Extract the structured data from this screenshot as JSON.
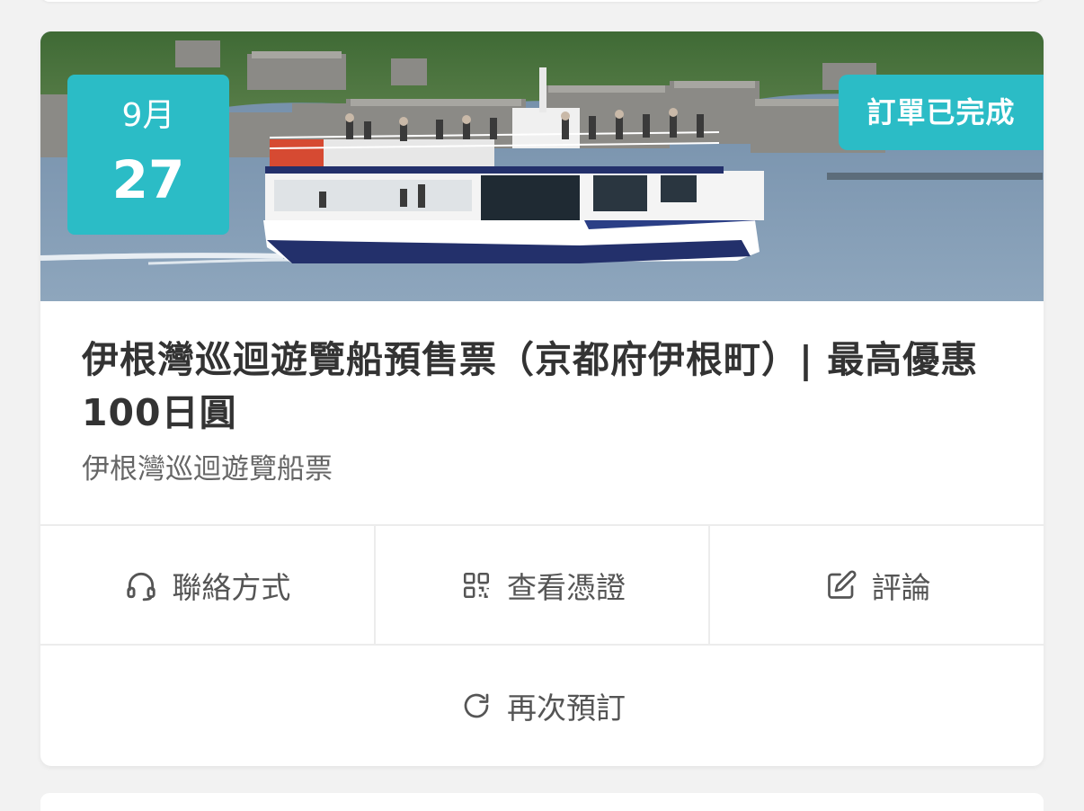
{
  "order_card": {
    "date": {
      "month": "9月",
      "day": "27"
    },
    "status": "訂單已完成",
    "title": "伊根灣巡迴遊覽船預售票（京都府伊根町）| 最高優惠100日圓",
    "subtitle": "伊根灣巡迴遊覽船票",
    "image_alt": "Ine Bay sightseeing boat",
    "actions": [
      {
        "label": "聯絡方式",
        "icon": "headset-icon"
      },
      {
        "label": "查看憑證",
        "icon": "qr-code-icon"
      },
      {
        "label": "評論",
        "icon": "edit-icon"
      }
    ],
    "rebook": {
      "label": "再次預訂",
      "icon": "refresh-icon"
    }
  },
  "colors": {
    "accent": "#2bbcc6",
    "text_primary": "#333333",
    "text_secondary": "#666666"
  }
}
